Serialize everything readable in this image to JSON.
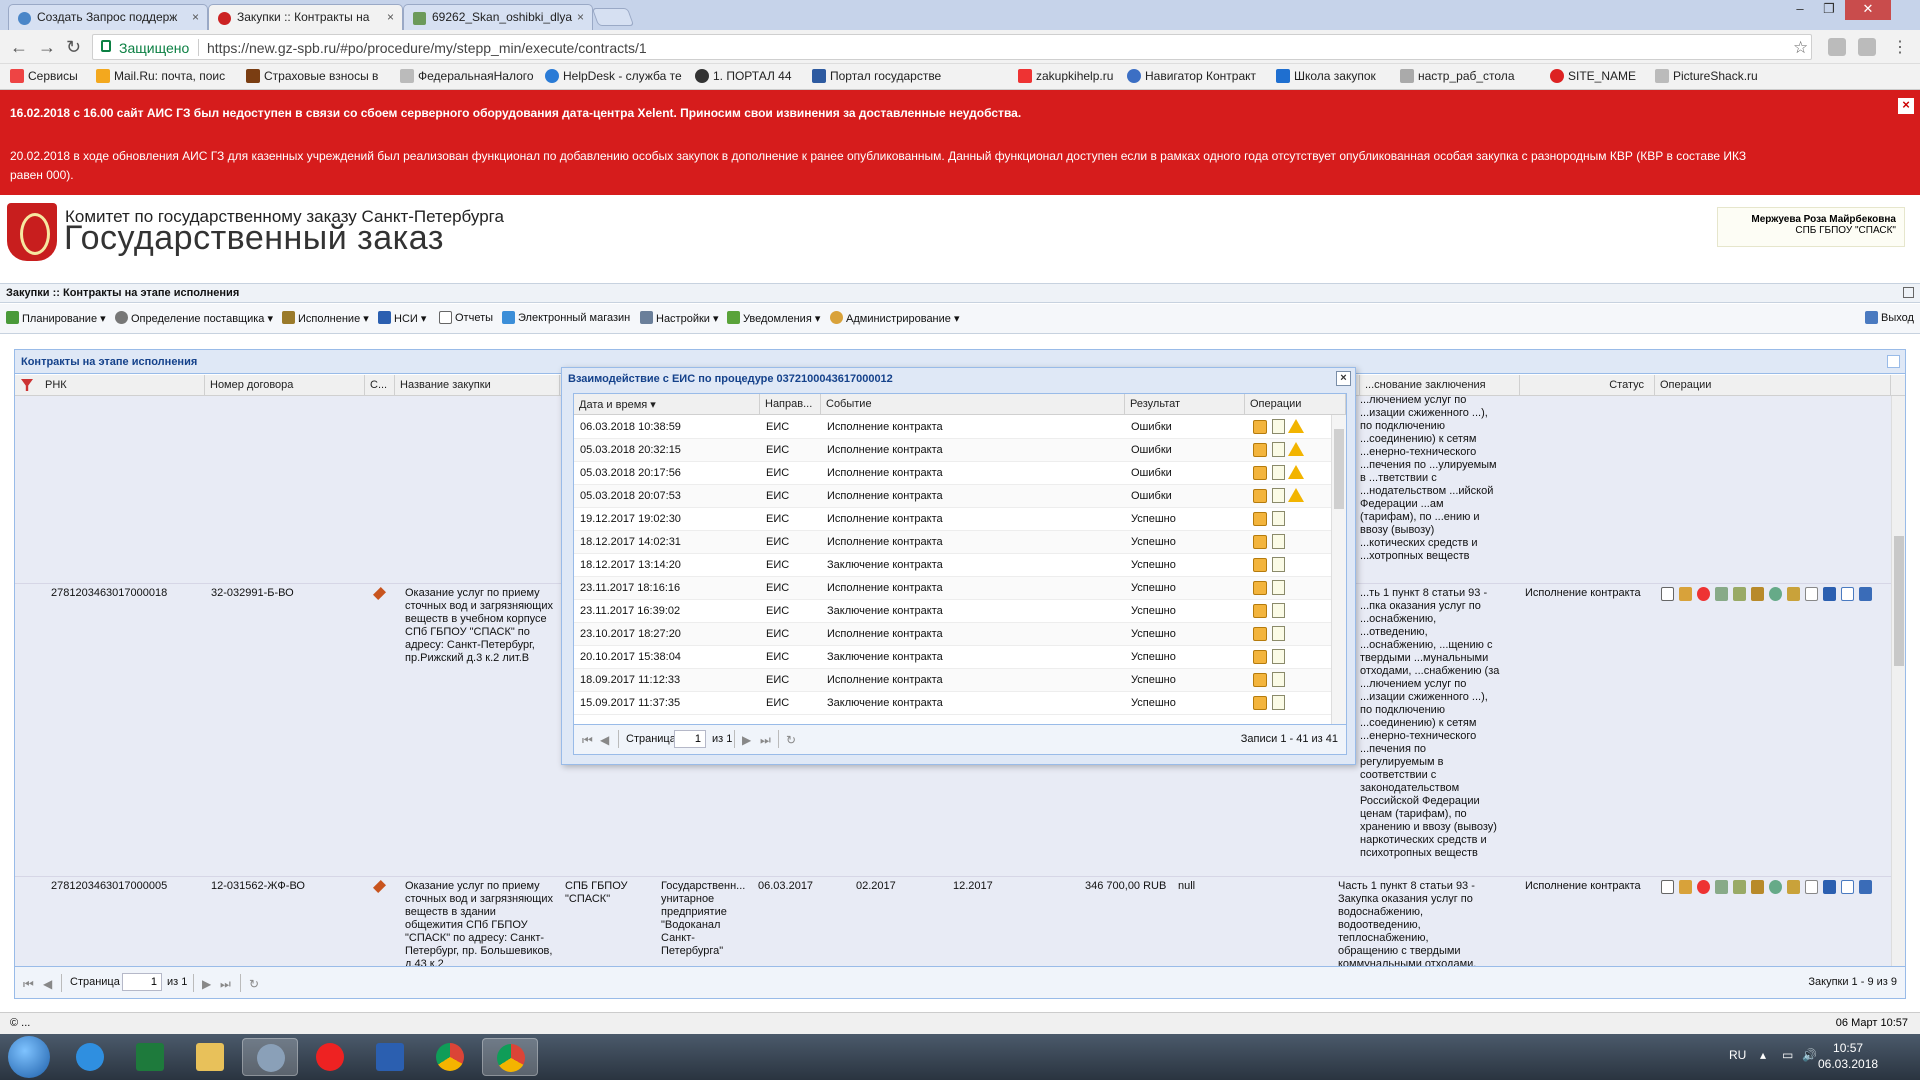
{
  "browser": {
    "tabs": [
      {
        "title": "Создать Запрос поддерж"
      },
      {
        "title": "Закупки :: Контракты на"
      },
      {
        "title": "69262_Skan_oshibki_dlya"
      }
    ],
    "secure_label": "Защищено",
    "url": "https://new.gz-spb.ru/#po/procedure/my/stepp_min/execute/contracts/1",
    "bookmarks": [
      "Сервисы",
      "Mail.Ru: почта, поис",
      "Страховые взносы в",
      "ФедеральнаяНалого",
      "HelpDesk - служба те",
      "1. ПОРТАЛ 44",
      "Портал государстве",
      "zakupkihelp.ru",
      "Навигатор Контракт",
      "Школа закупок",
      "настр_раб_стола",
      "SITE_NAME",
      "PictureShack.ru"
    ]
  },
  "banner": {
    "line1": "16.02.2018 с 16.00 сайт АИС ГЗ был недоступен в связи со сбоем серверного оборудования дата-центра Xelent. Приносим свои извинения за доставленные неудобства.",
    "line2": "20.02.2018 в ходе обновления АИС ГЗ для казенных учреждений был реализован функционал по добавлению особых закупок в дополнение к ранее опубликованным. Данный функционал доступен если в рамках одного года отсутствует опубликованная особая закупка с разнородным КВР (КВР в составе ИКЗ",
    "line3": "равен 000).",
    "close": "×"
  },
  "header": {
    "org_line1": "Комитет по государственному заказу Санкт-Петербурга",
    "org_line2": "Государственный заказ",
    "user_name": "Мержуева Роза Майрбековна",
    "user_org": "СПБ ГБПОУ \"СПАСК\""
  },
  "page_title": "Закупки :: Контракты на этапе исполнения",
  "menu": {
    "items": [
      "Планирование",
      "Определение поставщика",
      "Исполнение",
      "НСИ",
      "Отчеты",
      "Электронный магазин",
      "Настройки",
      "Уведомления",
      "Администрирование"
    ],
    "exit": "Выход"
  },
  "panel": {
    "title": "Контракты на этапе исполнения",
    "columns": [
      "РНК",
      "Номер договора",
      "С...",
      "Название закупки",
      "...снование заключения",
      "Статус",
      "Операции"
    ],
    "rows": [
      {
        "rnk": "",
        "contract_no": "",
        "name": "",
        "supplier": "",
        "customer": "",
        "date": "",
        "start": "",
        "end": "",
        "amount": "",
        "extra": "",
        "basis": "...лючением услуг по ...изации сжиженного ...), по подключению ...соединению) к сетям ...енерно-технического ...печения по ...улируемым в ...тветствии с ...нодательством ...ийской Федерации ...ам (тарифам), по ...ению и ввозу (вывозу) ...котических средств и ...хотропных веществ",
        "status": ""
      },
      {
        "rnk": "2781203463017000018",
        "contract_no": "32-032991-Б-ВО",
        "name": "Оказание услуг по приему сточных вод и загрязняющих веществ в учебном корпусе СПб ГБПОУ \"СПАСК\" по адресу: Санкт-Петербург, пр.Рижский д.3 к.2 лит.В",
        "supplier": "",
        "customer": "",
        "date": "",
        "start": "",
        "end": "",
        "amount": "",
        "extra": "",
        "basis": "...ть 1 пункт 8 статьи 93 - ...пка оказания услуг по ...оснабжению, ...отведению, ...оснабжению, ...щению с твердыми ...мунальными отходами, ...снабжению (за ...лючением услуг по ...изации сжиженного ...), по подключению ...соединению) к сетям ...енерно-технического ...печения по регулируемым в соответствии с законодательством Российской Федерации ценам (тарифам), по хранению и ввозу (вывозу) наркотических средств и психотропных веществ",
        "status": "Исполнение контракта"
      },
      {
        "rnk": "2781203463017000005",
        "contract_no": "12-031562-ЖФ-ВО",
        "name": "Оказание услуг по приему сточных вод и загрязняющих веществ в здании общежития СПб ГБПОУ \"СПАСК\" по адресу: Санкт-Петербург, пр. Большевиков, д.43 к.2",
        "supplier": "СПБ ГБПОУ \"СПАСК\"",
        "customer": "Государственн... унитарное предприятие \"Водоканал Санкт-Петербурга\"",
        "date": "06.03.2017",
        "start": "02.2017",
        "end": "12.2017",
        "amount": "346 700,00 RUB",
        "extra": "null",
        "basis": "Часть 1 пункт 8 статьи 93 - Закупка оказания услуг по водоснабжению, водоотведению, теплоснабжению, обращению с твердыми коммунальными отходами,",
        "status": "Исполнение контракта"
      }
    ],
    "pager": {
      "page_label": "Страница",
      "page": "1",
      "of": "из 1",
      "summary": "Закупки 1 - 9 из 9"
    }
  },
  "modal": {
    "title": "Взаимодействие с ЕИС по процедуре 0372100043617000012",
    "close": "×",
    "columns": [
      "Дата и время ▾",
      "Направ...",
      "Событие",
      "Результат",
      "Операции"
    ],
    "rows": [
      {
        "dt": "06.03.2018 10:38:59",
        "dir": "ЕИС",
        "event": "Исполнение контракта",
        "result": "Ошибки",
        "warn": true
      },
      {
        "dt": "05.03.2018 20:32:15",
        "dir": "ЕИС",
        "event": "Исполнение контракта",
        "result": "Ошибки",
        "warn": true
      },
      {
        "dt": "05.03.2018 20:17:56",
        "dir": "ЕИС",
        "event": "Исполнение контракта",
        "result": "Ошибки",
        "warn": true
      },
      {
        "dt": "05.03.2018 20:07:53",
        "dir": "ЕИС",
        "event": "Исполнение контракта",
        "result": "Ошибки",
        "warn": true
      },
      {
        "dt": "19.12.2017 19:02:30",
        "dir": "ЕИС",
        "event": "Исполнение контракта",
        "result": "Успешно",
        "warn": false
      },
      {
        "dt": "18.12.2017 14:02:31",
        "dir": "ЕИС",
        "event": "Исполнение контракта",
        "result": "Успешно",
        "warn": false
      },
      {
        "dt": "18.12.2017 13:14:20",
        "dir": "ЕИС",
        "event": "Заключение контракта",
        "result": "Успешно",
        "warn": false
      },
      {
        "dt": "23.11.2017 18:16:16",
        "dir": "ЕИС",
        "event": "Исполнение контракта",
        "result": "Успешно",
        "warn": false
      },
      {
        "dt": "23.11.2017 16:39:02",
        "dir": "ЕИС",
        "event": "Заключение контракта",
        "result": "Успешно",
        "warn": false
      },
      {
        "dt": "23.10.2017 18:27:20",
        "dir": "ЕИС",
        "event": "Исполнение контракта",
        "result": "Успешно",
        "warn": false
      },
      {
        "dt": "20.10.2017 15:38:04",
        "dir": "ЕИС",
        "event": "Заключение контракта",
        "result": "Успешно",
        "warn": false
      },
      {
        "dt": "18.09.2017 11:12:33",
        "dir": "ЕИС",
        "event": "Исполнение контракта",
        "result": "Успешно",
        "warn": false
      },
      {
        "dt": "15.09.2017 11:37:35",
        "dir": "ЕИС",
        "event": "Заключение контракта",
        "result": "Успешно",
        "warn": false
      }
    ],
    "pager": {
      "page_label": "Страница",
      "page": "1",
      "of": "из 1",
      "summary": "Записи 1 - 41 из 41"
    }
  },
  "statusbar": {
    "left": "© ...",
    "right": "06 Март 10:57"
  },
  "taskbar": {
    "lang": "RU",
    "time": "10:57",
    "date": "06.03.2018"
  }
}
